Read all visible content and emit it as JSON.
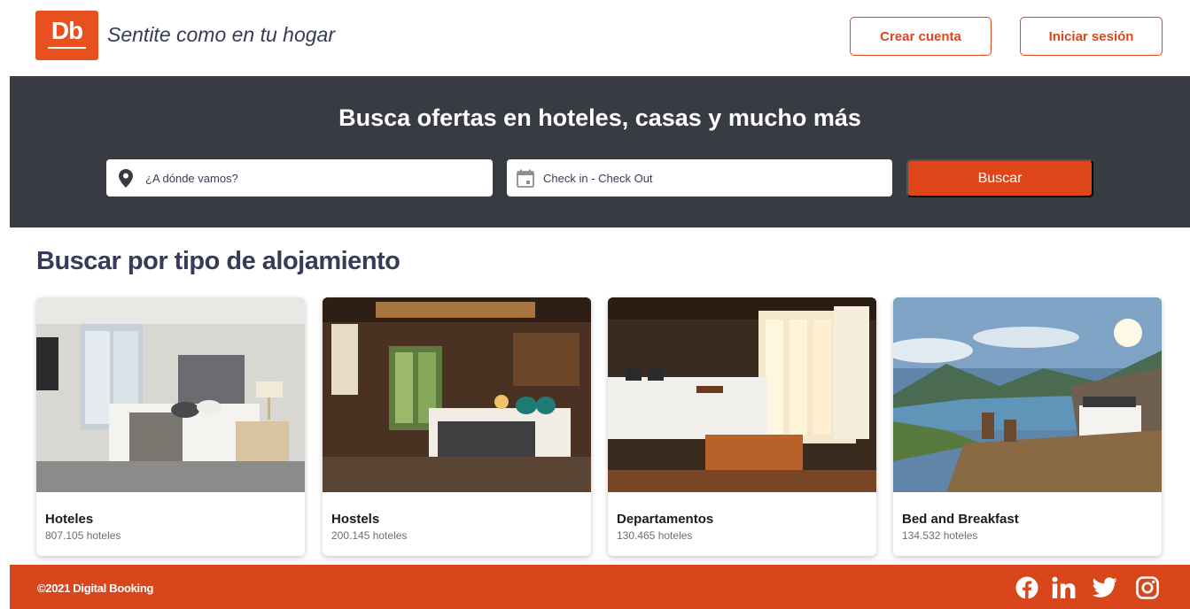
{
  "header": {
    "logo_text": "Db",
    "slogan": "Sentite como en tu hogar",
    "create_account_label": "Crear cuenta",
    "login_label": "Iniciar sesión"
  },
  "search": {
    "title": "Busca ofertas en hoteles, casas y mucho más",
    "destination_placeholder": "¿A dónde vamos?",
    "destination_value": "",
    "dates_placeholder": "Check in - Check Out",
    "dates_value": "",
    "button_label": "Buscar",
    "destination_icon": "location-pin-icon",
    "dates_icon": "calendar-icon"
  },
  "categories": {
    "title": "Buscar por tipo de alojamiento",
    "items": [
      {
        "title": "Hoteles",
        "count": "807.105 hoteles",
        "image": "hotel-room-photo"
      },
      {
        "title": "Hostels",
        "count": "200.145 hoteles",
        "image": "hostel-room-photo"
      },
      {
        "title": "Departamentos",
        "count": "130.465 hoteles",
        "image": "apartment-room-photo"
      },
      {
        "title": "Bed and Breakfast",
        "count": "134.532 hoteles",
        "image": "bed-and-breakfast-photo"
      }
    ]
  },
  "footer": {
    "copyright": "©2021 Digital Booking",
    "social": [
      "facebook-icon",
      "linkedin-icon",
      "twitter-icon",
      "instagram-icon"
    ]
  },
  "colors": {
    "brand": "#e0461b",
    "footer": "#d9461b",
    "search_band": "#383b41",
    "text_dark": "#383b58"
  }
}
